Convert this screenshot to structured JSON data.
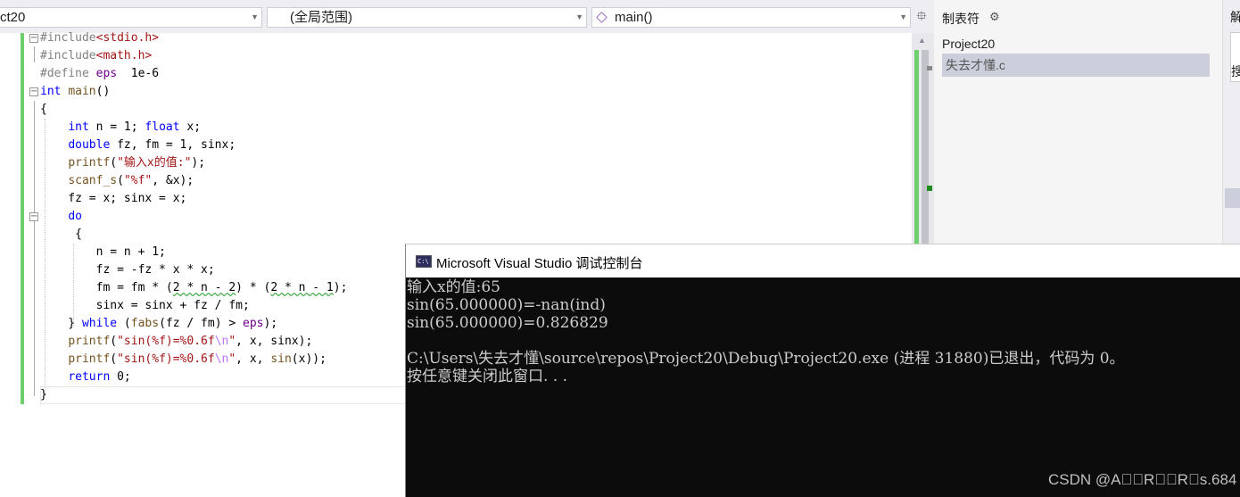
{
  "navbar": {
    "project_combo": "ct20",
    "scope_combo": "(全局范围)",
    "function_combo": "main()"
  },
  "code_lines": [
    {
      "segments": [
        [
          "pp",
          "#include"
        ],
        [
          "str",
          "<stdio.h>"
        ]
      ]
    },
    {
      "segments": [
        [
          "pp",
          "#include"
        ],
        [
          "str",
          "<math.h>"
        ]
      ]
    },
    {
      "segments": [
        [
          "pp",
          "#define "
        ],
        [
          "mac",
          "eps"
        ],
        [
          "",
          "  1e-6"
        ]
      ]
    },
    {
      "segments": [
        [
          "kw",
          "int"
        ],
        [
          "",
          " "
        ],
        [
          "fn",
          "main"
        ],
        [
          "",
          "()"
        ]
      ]
    },
    {
      "segments": [
        [
          "",
          "{"
        ]
      ]
    },
    {
      "segments": [
        [
          "",
          "    "
        ],
        [
          "kw",
          "int"
        ],
        [
          "",
          " n = 1; "
        ],
        [
          "kw",
          "float"
        ],
        [
          "",
          " x;"
        ]
      ]
    },
    {
      "segments": [
        [
          "",
          "    "
        ],
        [
          "kw",
          "double"
        ],
        [
          "",
          " fz, fm = 1, sinx;"
        ]
      ]
    },
    {
      "segments": [
        [
          "",
          "    "
        ],
        [
          "fn",
          "printf"
        ],
        [
          "",
          "("
        ],
        [
          "str",
          "\"输入x的值:\""
        ],
        [
          "",
          ");"
        ]
      ]
    },
    {
      "segments": [
        [
          "",
          "    "
        ],
        [
          "fn",
          "scanf_s"
        ],
        [
          "",
          "("
        ],
        [
          "str",
          "\"%f\""
        ],
        [
          "",
          ", &x);"
        ]
      ]
    },
    {
      "segments": [
        [
          "",
          "    fz = x; sinx = x;"
        ]
      ]
    },
    {
      "segments": [
        [
          "",
          "    "
        ],
        [
          "kw",
          "do"
        ]
      ]
    },
    {
      "segments": [
        [
          "",
          "     {"
        ]
      ]
    },
    {
      "segments": [
        [
          "",
          "        n = n + 1;"
        ]
      ]
    },
    {
      "segments": [
        [
          "",
          "        fz = -fz * x * x;"
        ]
      ]
    },
    {
      "segments": [
        [
          "",
          "        fm = fm * ("
        ],
        [
          "sq",
          "2 * n - 2"
        ],
        [
          "",
          ") * ("
        ],
        [
          "sq",
          "2 * n - 1"
        ],
        [
          "",
          ");"
        ]
      ]
    },
    {
      "segments": [
        [
          "",
          "        sinx = sinx + fz / fm;"
        ]
      ]
    },
    {
      "segments": [
        [
          "",
          "    } "
        ],
        [
          "kw",
          "while"
        ],
        [
          "",
          " ("
        ],
        [
          "fn",
          "fabs"
        ],
        [
          "",
          "(fz / fm) > "
        ],
        [
          "mac",
          "eps"
        ],
        [
          "",
          ");"
        ]
      ]
    },
    {
      "segments": [
        [
          "",
          "    "
        ],
        [
          "fn",
          "printf"
        ],
        [
          "",
          "("
        ],
        [
          "str",
          "\"sin(%f)=%0.6f"
        ],
        [
          "esc",
          "\\n"
        ],
        [
          "str",
          "\""
        ],
        [
          "",
          ", x, sinx);"
        ]
      ]
    },
    {
      "segments": [
        [
          "",
          "    "
        ],
        [
          "fn",
          "printf"
        ],
        [
          "",
          "("
        ],
        [
          "str",
          "\"sin(%f)=%0.6f"
        ],
        [
          "esc",
          "\\n"
        ],
        [
          "str",
          "\""
        ],
        [
          "",
          ", x, "
        ],
        [
          "fn",
          "sin"
        ],
        [
          "",
          "(x));"
        ]
      ]
    },
    {
      "segments": [
        [
          "",
          "    "
        ],
        [
          "kw",
          "return"
        ],
        [
          "",
          " 0;"
        ]
      ]
    },
    {
      "segments": [
        [
          "",
          "}"
        ]
      ]
    }
  ],
  "panel": {
    "title": "制表符",
    "items": [
      "Project20",
      "失去才懂.c"
    ]
  },
  "right_edge": {
    "t1": "解",
    "t2": "搜"
  },
  "console": {
    "title": "Microsoft Visual Studio 调试控制台",
    "icon_text": "C:\\",
    "lines": [
      "输入x的值:65",
      "sin(65.000000)=-nan(ind)",
      "sin(65.000000)=0.826829",
      "",
      "C:\\Users\\失去才懂\\source\\repos\\Project20\\Debug\\Project20.exe (进程 31880)已退出，代码为 0。",
      "按任意键关闭此窗口. . ."
    ],
    "watermark": "CSDN @A\u0000\u0000R\u0000\u0000R\u0000s.684"
  }
}
